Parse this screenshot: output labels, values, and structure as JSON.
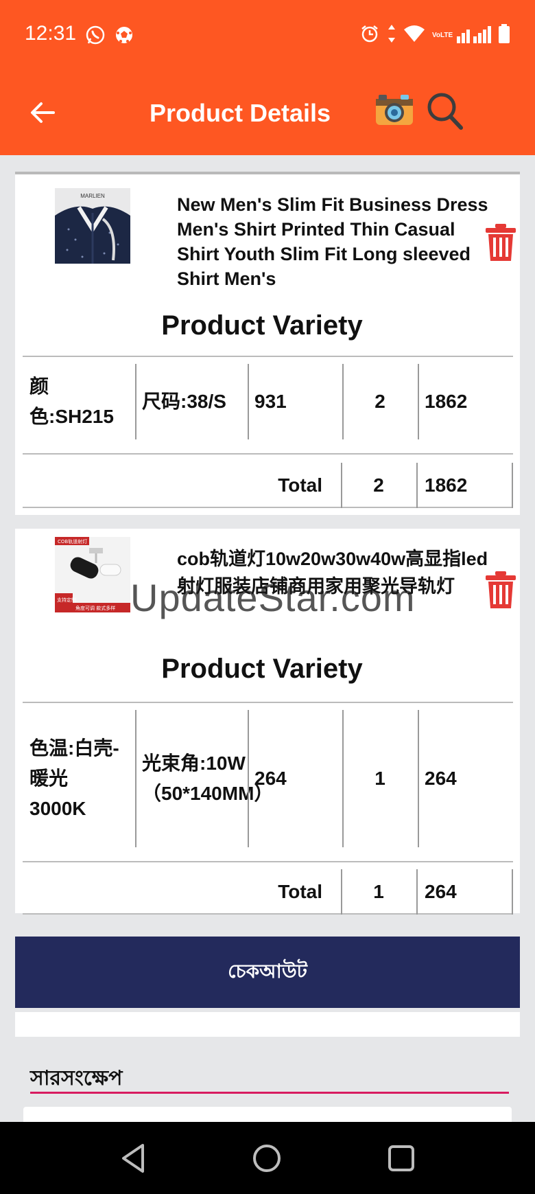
{
  "status_bar": {
    "time": "12:31",
    "left_icons": [
      "whatsapp-icon",
      "football-icon"
    ],
    "right_icons": [
      "alarm-icon",
      "data-arrows-icon",
      "wifi-icon",
      "volte-icon",
      "signal-icon",
      "battery-icon"
    ],
    "volte_text": "VoLTE"
  },
  "app_bar": {
    "title": "Product Details",
    "back_icon": "arrow-left-icon",
    "camera_icon": "camera-icon",
    "search_icon": "search-icon",
    "background": "#fe5722"
  },
  "products": [
    {
      "name": "New Men's Slim Fit Business Dress Men's Shirt Printed Thin Casual Shirt Youth Slim Fit Long sleeved Shirt Men's",
      "thumb_text": "MARLIEN",
      "variety_title": "Product Variety",
      "variant": {
        "color": "颜色:SH215",
        "size": "尺码:38/S",
        "price": "931",
        "qty": "2",
        "subtotal": "1862"
      },
      "total_label": "Total",
      "total_qty": "2",
      "total_sum": "1862"
    },
    {
      "name": "cob轨道灯10w20w30w40w高显指led射灯服装店铺商用家用聚光导轨灯",
      "thumb_label": "COB轨道射灯",
      "thumb_badge": "支持定制",
      "thumb_footer": "角度可调 款式多样",
      "variety_title": "Product Variety",
      "variant": {
        "color": "色温:白壳-暖光3000K",
        "size": "光束角:10W（50*140MM）",
        "price": "264",
        "qty": "1",
        "subtotal": "264"
      },
      "total_label": "Total",
      "total_qty": "1",
      "total_sum": "264"
    }
  ],
  "checkout": {
    "label": "চেকআউট",
    "background": "#232a5c"
  },
  "summary": {
    "title": "সারসংক্ষেপ",
    "accent": "#d81b60"
  },
  "watermark": "UpdateStar.com",
  "nav_bar": {
    "icons": [
      "back-triangle-icon",
      "home-circle-icon",
      "recents-square-icon"
    ]
  }
}
